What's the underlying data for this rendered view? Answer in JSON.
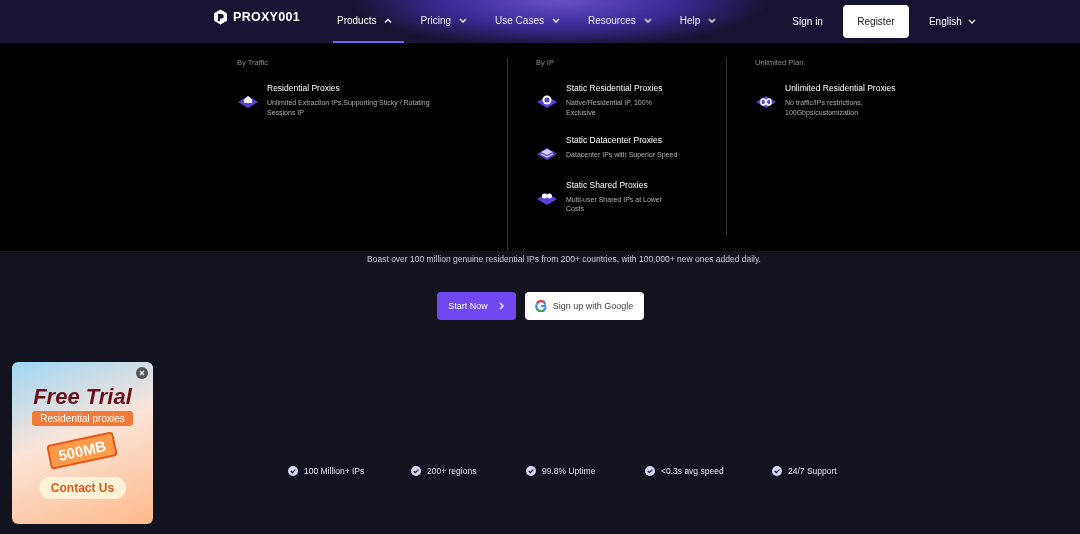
{
  "brand": "PROXY001",
  "nav": [
    {
      "label": "Products",
      "selected": true,
      "expanded": true
    },
    {
      "label": "Pricing",
      "selected": false,
      "expanded": false
    },
    {
      "label": "Use Cases",
      "selected": false,
      "expanded": false
    },
    {
      "label": "Resources",
      "selected": false,
      "expanded": false
    },
    {
      "label": "Help",
      "selected": false,
      "expanded": false
    }
  ],
  "sign_in": "Sign in",
  "register": "Register",
  "language": "English",
  "menu": [
    {
      "heading": "By Traffic",
      "items": [
        {
          "kind": "home",
          "title": "Residential Proxies",
          "desc": "Unlimited Extraction IPs,Supporting Sticky / Rotating Sessions IP"
        }
      ]
    },
    {
      "heading": "By IP",
      "items": [
        {
          "kind": "globe",
          "title": "Static Residential Proxies",
          "desc": "Native/Residential IP, 100% Exclusive"
        },
        {
          "kind": "stack",
          "title": "Static Datacenter Proxies",
          "desc": "Datacenter IPs with Superior Speed"
        },
        {
          "kind": "people",
          "title": "Static Shared Proxies",
          "desc": "Multi-user Shared IPs at Lower Costs"
        }
      ]
    },
    {
      "heading": "Unlimited Plan",
      "items": [
        {
          "kind": "infinity",
          "title": "Unlimited Residential Proxies",
          "desc": "No traffic/IPs restrictions, 100Gbps/customization"
        }
      ]
    }
  ],
  "hero": {
    "subtitle": "Boast over 100 million genuine residential IPs from 200+ countries, with 100,000+ new ones added daily.",
    "primary_button": "Start Now",
    "google_button": "Sign up with Google"
  },
  "promo": {
    "title": "Free Trial",
    "subtitle": "Residential proxies",
    "amount": "500MB",
    "button": "Contact Us"
  },
  "features": [
    "100 Million+ IPs",
    "200+ regions",
    "99.8% Uptime",
    "<0.3s avg speed",
    "24/7 Support"
  ]
}
